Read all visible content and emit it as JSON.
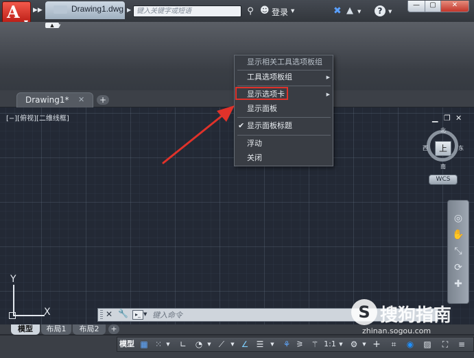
{
  "titlebar": {
    "app_button_glyph": "A",
    "doc_title": "Drawing1.dwg",
    "search_placeholder": "键入关键字或短语",
    "login_label": "登录",
    "help_glyph": "?"
  },
  "file_tabs": {
    "active_tab": "Drawing1*",
    "close_glyph": "✕",
    "add_glyph": "+"
  },
  "canvas": {
    "view_label": "[−][俯视][二维线框]",
    "viewcube": {
      "top_face": "上",
      "north": "北",
      "south": "南",
      "west": "西",
      "east": "东",
      "wcs_label": "WCS"
    },
    "ucs": {
      "x_label": "X",
      "y_label": "Y"
    }
  },
  "context_menu": {
    "items": [
      {
        "label": "显示相关工具选项板组",
        "enabled": false
      },
      {
        "label": "工具选项板组",
        "has_submenu": true
      },
      {
        "label": "显示选项卡",
        "has_submenu": true,
        "highlighted": true
      },
      {
        "label": "显示面板"
      },
      {
        "label": "显示面板标题",
        "checked": true
      },
      {
        "label": "浮动"
      },
      {
        "label": "关闭"
      }
    ],
    "check_glyph": "✔",
    "submenu_glyph": "▶"
  },
  "command_line": {
    "placeholder": "键入命令"
  },
  "layout_tabs": {
    "tabs": [
      "模型",
      "布局1",
      "布局2"
    ],
    "add_glyph": "+"
  },
  "status_bar": {
    "model_label": "模型",
    "scale_label": "1:1"
  },
  "watermark": {
    "logo_glyph": "S",
    "title": "搜狗指南",
    "url": "zhinan.sogou.com"
  },
  "colors": {
    "accent_red": "#e0322a",
    "canvas_bg": "#232935",
    "app_button": "#d9261c",
    "active_toggle": "#5fa8ff"
  }
}
